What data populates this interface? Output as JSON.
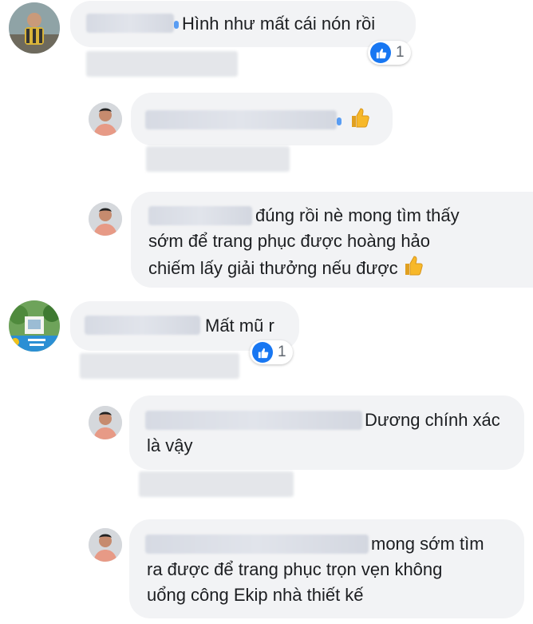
{
  "comments": [
    {
      "text": "Hình như mất cái nón rồi",
      "reaction_count": "1"
    },
    {
      "text": "",
      "emoji": "thumbs-up"
    },
    {
      "lines": [
        "đúng rồi nè mong tìm thấy",
        "sớm để trang phục được hoàng hảo",
        "chiếm lấy giải thưởng nếu được"
      ],
      "emoji": "thumbs-up"
    },
    {
      "text": "Mất mũ r",
      "reaction_count": "1"
    },
    {
      "lines": [
        "Dương chính xác",
        "là vậy"
      ]
    },
    {
      "lines": [
        "mong sớm tìm",
        "ra được để trang phục trọn vẹn không",
        "uổng công Ekip nhà thiết kế"
      ]
    }
  ],
  "colors": {
    "bubble": "#f2f3f5",
    "like": "#1877f2",
    "text": "#1c1e21"
  },
  "icons": [
    "avatar",
    "like-icon",
    "thumbs-up-icon"
  ]
}
